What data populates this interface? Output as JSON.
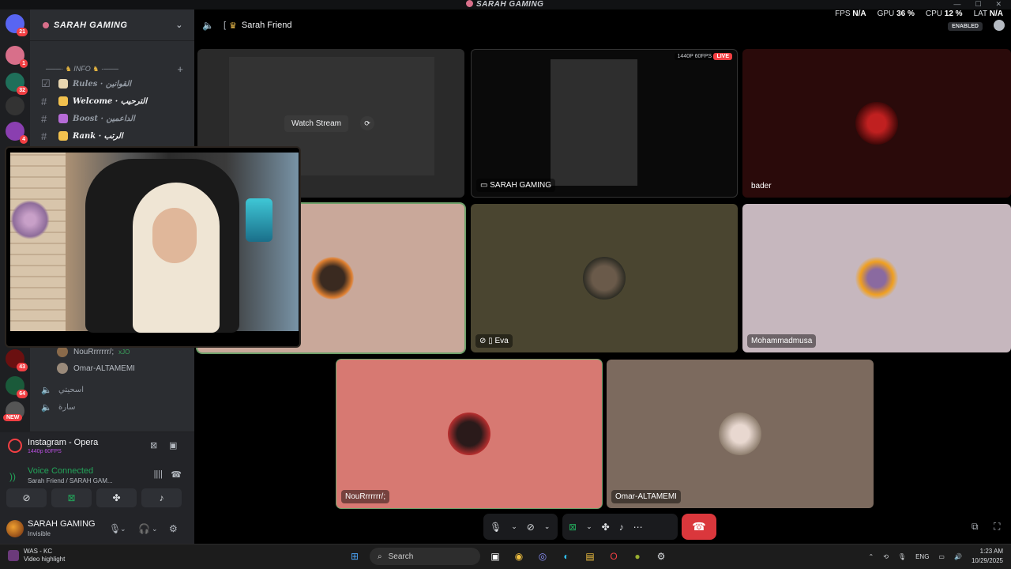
{
  "window": {
    "title": "SARAH GAMING"
  },
  "stats": {
    "fps_label": "FPS",
    "fps_value": "N/A",
    "gpu_label": "GPU",
    "gpu_value": "36 %",
    "cpu_label": "CPU",
    "cpu_value": "12 %",
    "lat_label": "LAT",
    "lat_value": "N/A",
    "enabled_badge": "ENABLED"
  },
  "rail": {
    "badges": [
      "21",
      "1",
      "32",
      "4",
      "43",
      "64"
    ],
    "new_label": "NEW"
  },
  "server": {
    "name": "SARAH GAMING"
  },
  "sidebar": {
    "category": "INFO",
    "channels": [
      {
        "label": "Rules · القوانين",
        "prefix": "ıl"
      },
      {
        "label": "Welcome · الترحيب",
        "prefix": "ıl"
      },
      {
        "label": "Boost · الداعمين",
        "prefix": "ıl"
      },
      {
        "label": "Rank · الرتب",
        "prefix": "ıl"
      }
    ],
    "voice_users": [
      {
        "name": "NouRrrrrrr/;",
        "tag": "xJO"
      },
      {
        "name": "Omar-ALTAMEMI"
      }
    ],
    "voice_channels": [
      "اسحيتي",
      "سارة"
    ]
  },
  "stream_panel": {
    "title": "Instagram - Opera",
    "quality": "1440p 60FPS"
  },
  "voice_panel": {
    "status": "Voice Connected",
    "channel": "Sarah Friend / SARAH GAM..."
  },
  "user_panel": {
    "name": "SARAH GAMING",
    "status": "Invisible"
  },
  "topbar": {
    "channel": "Sarah Friend"
  },
  "tiles": {
    "watch_stream": "Watch Stream",
    "stream_owner": "SARAH GAMING",
    "stream_quality": "1440P 60FPS",
    "live": "LIVE",
    "bader": "bader",
    "eva": "Eva",
    "mohammadmusa": "Mohammadmusa",
    "nour": "NouRrrrrrr/;",
    "omar": "Omar-ALTAMEMI"
  },
  "taskbar": {
    "notif_title": "WAS - KC",
    "notif_sub": "Video highlight",
    "search": "Search",
    "lang": "ENG",
    "time": "1:23 AM",
    "date": "10/29/2025"
  },
  "colors": {
    "accent_green": "#23a55a",
    "hangup": "#da373c",
    "live": "#f23f43"
  }
}
